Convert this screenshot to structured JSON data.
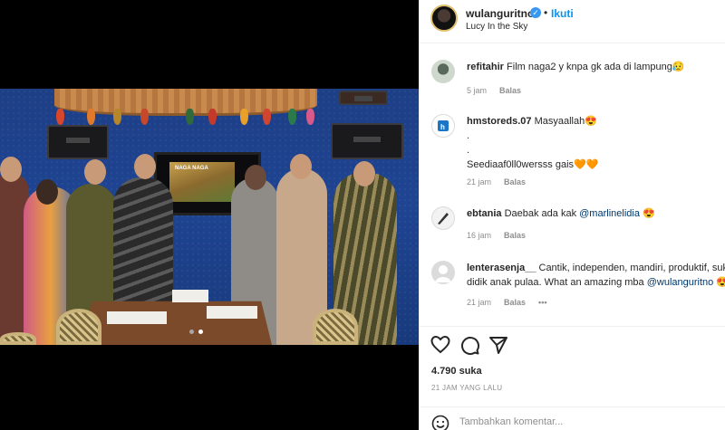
{
  "post": {
    "username": "wulanguritno",
    "follow_label": "Ikuti",
    "separator": "•",
    "location": "Lucy In the Sky",
    "verified_mark": "✓",
    "tv_screen_text": "NAGA NAGA"
  },
  "comments": [
    {
      "user": "refitahir",
      "text": "Film naga2 y knpa gk ada di lampung😥",
      "time": "5 jam",
      "reply": "Balas",
      "avatar_color": "#cfd8cc"
    },
    {
      "user": "hmstoreds.07",
      "text": "Masyaallah😍",
      "line2": ".",
      "line3": ".",
      "line4": "Seediaaf0ll0wersss gais🧡🧡",
      "time": "21 jam",
      "reply": "Balas",
      "avatar_color": "#1c76c8"
    },
    {
      "user": "ebtania",
      "text": "Daebak ada kak ",
      "mention": "@marlinelidia",
      "suffix": " 😍",
      "time": "16 jam",
      "reply": "Balas",
      "avatar_color": "#e8e8e8"
    },
    {
      "user": "lenterasenja__",
      "text": "Cantik, independen, mandiri, produktif, sukses",
      "line2": "didik anak pulaa. What an amazing mba ",
      "mention": "@wulanguritno",
      "suffix": " 😍",
      "time": "21 jam",
      "reply": "Balas",
      "more": "•••",
      "avatar_color": "#dbdbdb"
    }
  ],
  "actions": {
    "like_icon": "heart-icon",
    "comment_icon": "comment-icon",
    "share_icon": "share-icon",
    "likes": "4.790 suka",
    "date": "21 JAM YANG LALU"
  },
  "composer": {
    "placeholder": "Tambahkan komentar..."
  },
  "carousel": {
    "total": 2,
    "active": 1
  }
}
